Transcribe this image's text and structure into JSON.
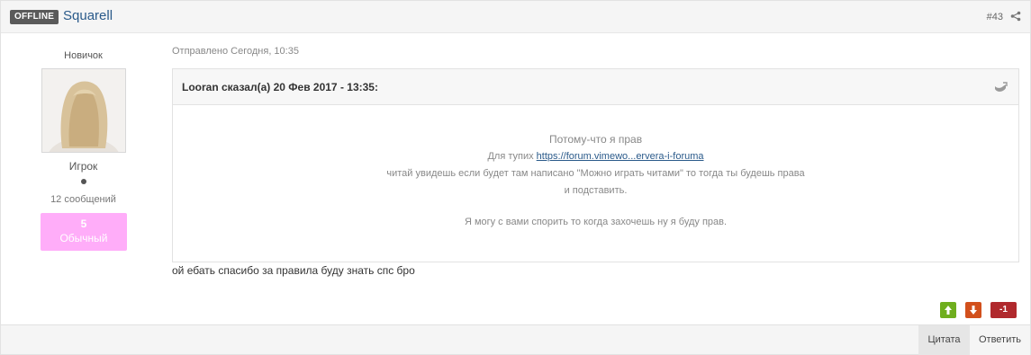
{
  "header": {
    "status_badge": "OFFLINE",
    "author": "Squarell",
    "post_number": "#43"
  },
  "author_panel": {
    "rank_title": "Новичок",
    "group": "Игрок",
    "post_count": "12 сообщений",
    "reputation_value": "5",
    "reputation_label": "Обычный"
  },
  "post": {
    "date": "Отправлено Сегодня, 10:35",
    "quote": {
      "citation": "Looran сказал(а) 20 Фев 2017 - 13:35:",
      "line1": "Потому-что я прав",
      "line2_prefix": "Для тупих ",
      "line2_link": "https://forum.vimewo...ervera-i-foruma",
      "line3": "читай увидешь если будет там написано \"Можно играть читами\" то тогда ты будешь права",
      "line4": "и подставить.",
      "line5": "Я могу с вами спорить то когда захочешь ну я буду прав."
    },
    "body": "ой ебать спасибо за правила буду знать спс бро"
  },
  "reputation": {
    "total": "-1",
    "up_color": "#6fae1e",
    "down_color": "#d2501c",
    "total_color": "#b0292d"
  },
  "footer": {
    "quote_button": "Цитата",
    "reply_button": "Ответить"
  },
  "icons": {
    "share": "share-icon",
    "quote_jump": "quote-jump-icon",
    "vote_up": "arrow-up-icon",
    "vote_down": "arrow-down-icon"
  }
}
